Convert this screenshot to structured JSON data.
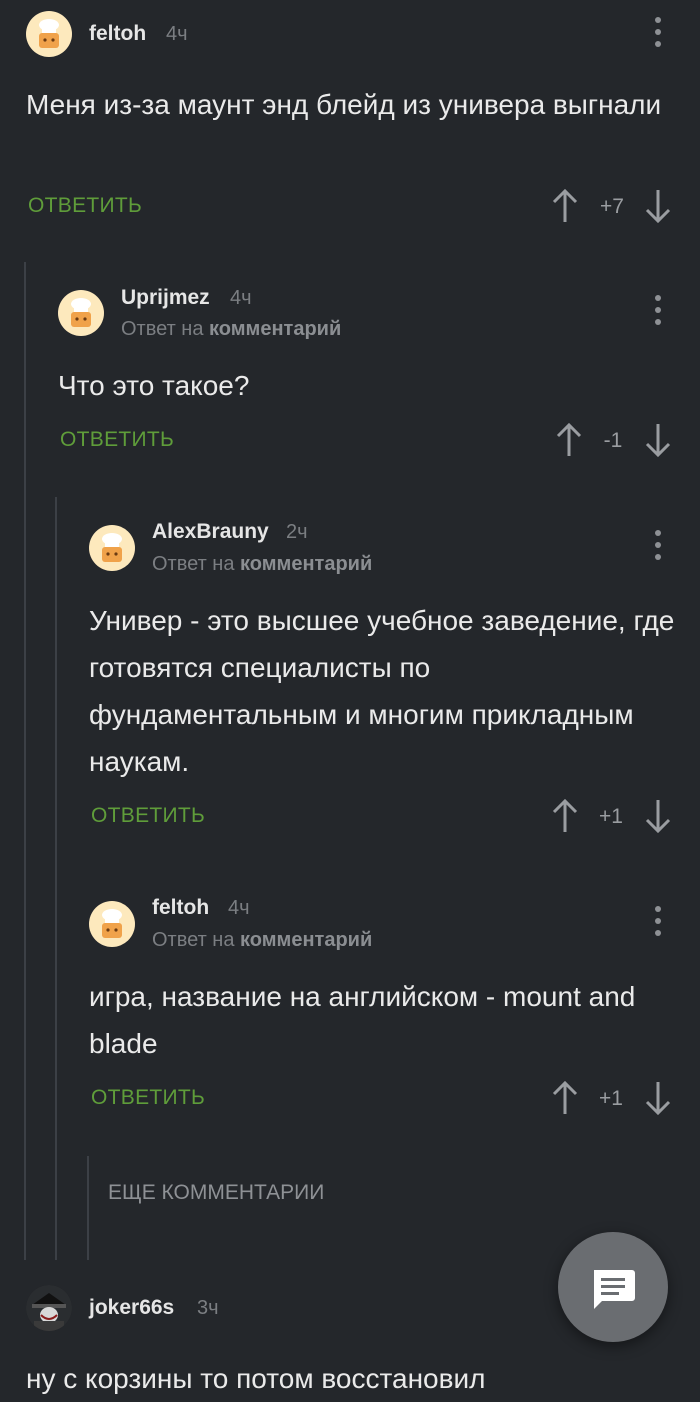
{
  "comments": [
    {
      "author": "feltoh",
      "time": "4ч",
      "text": "Меня из-за маунт энд блейд из универа выгнали",
      "reply_label": "ОТВЕТИТЬ",
      "rating": "+7"
    },
    {
      "author": "Uprijmez",
      "time": "4ч",
      "reply_prefix": "Ответ на",
      "reply_link": "комментарий",
      "text": "Что это такое?",
      "reply_label": "ОТВЕТИТЬ",
      "rating": "-1"
    },
    {
      "author": "AlexBrauny",
      "time": "2ч",
      "reply_prefix": "Ответ на",
      "reply_link": "комментарий",
      "text": "Универ - это высшее учебное заведение, где готовятся специалисты по фундаментальным и многим прикладным наукам.",
      "reply_label": "ОТВЕТИТЬ",
      "rating": "+1"
    },
    {
      "author": "feltoh",
      "time": "4ч",
      "reply_prefix": "Ответ на",
      "reply_link": "комментарий",
      "text": "игра, название на английском - mount and blade",
      "reply_label": "ОТВЕТИТЬ",
      "rating": "+1"
    },
    {
      "author": "joker66s",
      "time": "3ч",
      "text": "ну с корзины то потом восстановил"
    }
  ],
  "more_comments_label": "ЕЩЕ КОММЕНТАРИИ",
  "icons": {
    "avatar": "chef-avatar-icon",
    "more": "more-vertical-icon",
    "up": "arrow-up-icon",
    "down": "arrow-down-icon",
    "fab": "message-icon"
  },
  "colors": {
    "background": "#24272b",
    "accent": "#5f9d3a",
    "muted": "#7b7e82",
    "fab": "#6a6d71"
  }
}
